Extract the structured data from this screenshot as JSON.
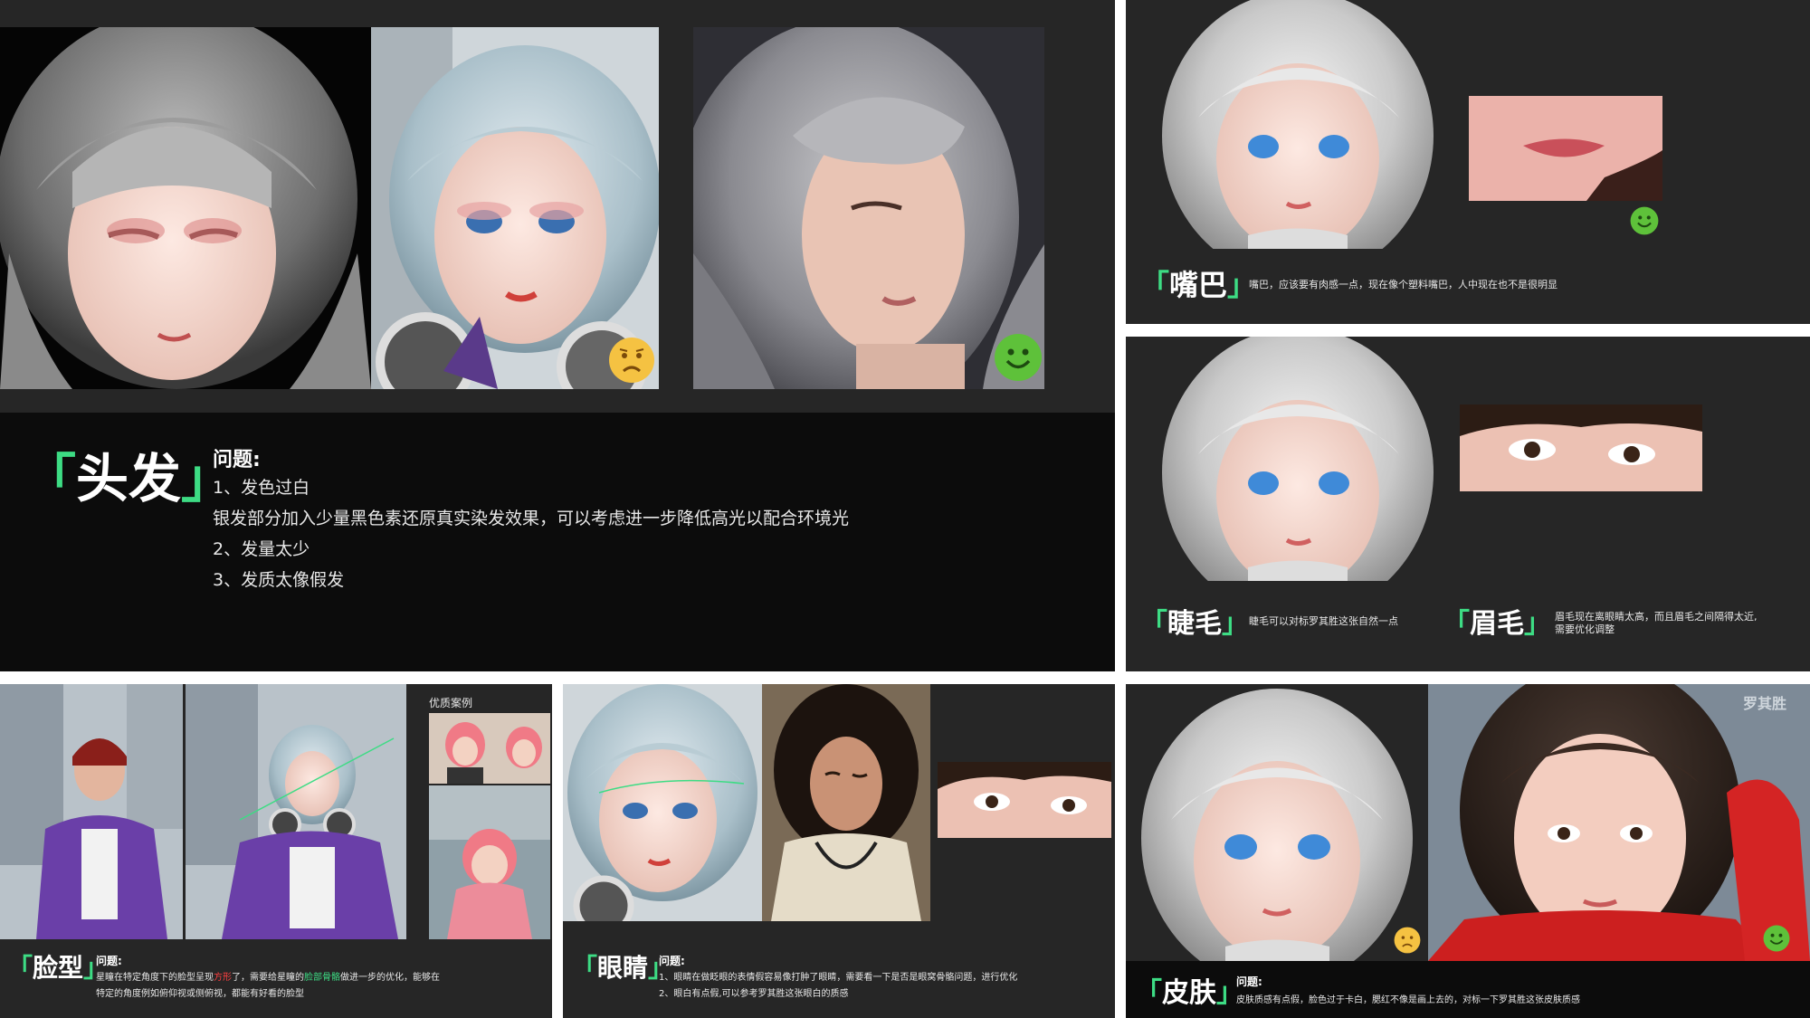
{
  "hair": {
    "title": "头发",
    "problem_label": "问题:",
    "lines": [
      "1、发色过白",
      "银发部分加入少量黑色素还原真实染发效果，可以考虑进一步降低高光以配合环境光",
      "2、发量太少",
      "3、发质太像假发"
    ]
  },
  "mouth": {
    "title": "嘴巴",
    "desc": "嘴巴，应该要有肉感一点，现在像个塑料嘴巴，人中现在也不是很明显"
  },
  "eyelash": {
    "title": "睫毛",
    "desc": "睫毛可以对标罗其胜这张自然一点"
  },
  "eyebrow": {
    "title": "眉毛",
    "desc_line1": "眉毛现在离眼睛太高，而且眉毛之间隔得太近,",
    "desc_line2": "需要优化调整"
  },
  "face": {
    "title": "脸型",
    "problem_label": "问题:",
    "line1_a": "星瞳在特定角度下的脸型呈现",
    "line1_red": "方形",
    "line1_b": "了，需要给星瞳的",
    "line1_green": "脸部骨骼",
    "line1_c": "做进一步的优化，能够在",
    "line2": "特定的角度例如俯仰视或侧俯视，都能有好看的脸型",
    "showcase_label": "优质案例"
  },
  "eyes": {
    "title": "眼睛",
    "problem_label": "问题:",
    "line1": "1、眼睛在做眨眼的表情假容易像打肿了眼睛，需要看一下是否是眼窝骨骼问题，进行优化",
    "line2": "2、眼白有点假,可以参考罗其胜这张眼白的质感"
  },
  "skin": {
    "title": "皮肤",
    "problem_label": "问题:",
    "line1": "皮肤质感有点假，脸色过于卡白，腮红不像是画上去的，对标一下罗其胜这张皮肤质感",
    "ref_name": "罗其胜"
  },
  "icons": {
    "sad": "sad-face-icon",
    "happy": "happy-face-icon"
  },
  "colors": {
    "accent_green": "#3ddc84",
    "panel_bg": "#262626",
    "dark_bg": "#0c0c0c",
    "emoji_yellow": "#f5c242",
    "emoji_green": "#5ec13a"
  }
}
